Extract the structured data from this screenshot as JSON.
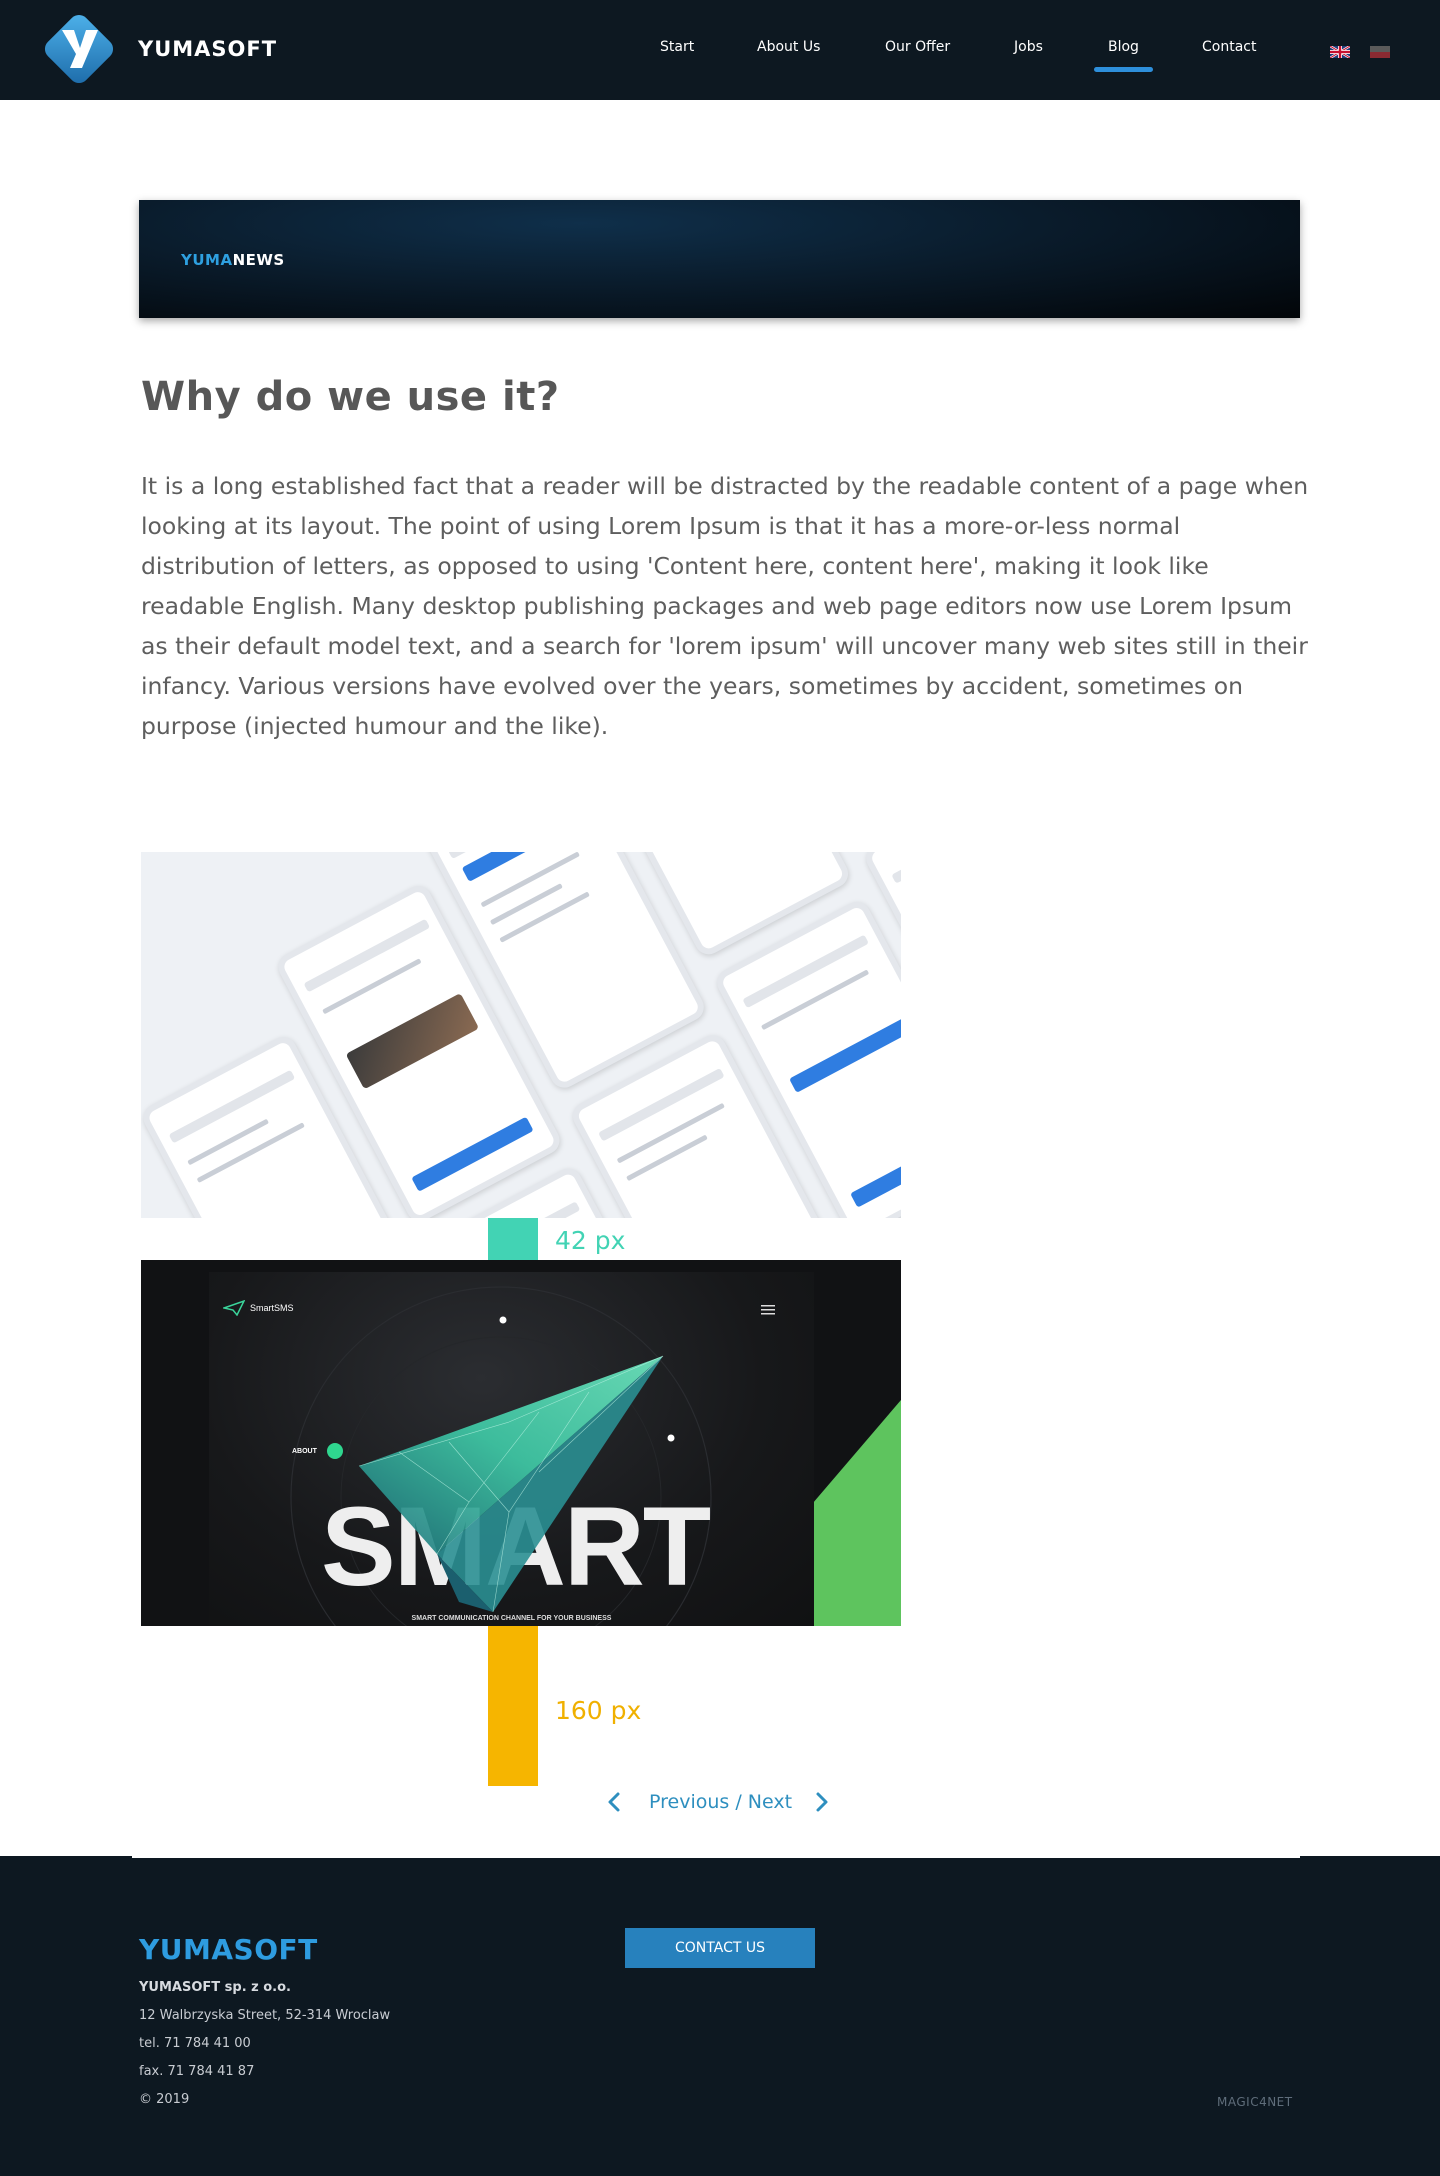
{
  "header": {
    "brand": "YUMASOFT",
    "nav": [
      {
        "label": "Start",
        "active": false
      },
      {
        "label": "About Us",
        "active": false
      },
      {
        "label": "Our Offer",
        "active": false
      },
      {
        "label": "Jobs",
        "active": false
      },
      {
        "label": "Blog",
        "active": true
      },
      {
        "label": "Contact",
        "active": false
      }
    ],
    "languages": [
      "en",
      "pl"
    ],
    "accent_color": "#2e8fdb",
    "background_color": "#0d1821"
  },
  "banner": {
    "tag_prefix": "YUMA",
    "tag_suffix": "NEWS"
  },
  "article": {
    "title": "Why do we use it?",
    "body": "It is a long established fact that a reader will be distracted by the readable content of a page when looking at its layout. The point of using Lorem Ipsum is that it has a more-or-less normal distribution of letters, as opposed to using 'Content here, content here', making it look like readable English. Many desktop publishing packages and web page editors now use Lorem Ipsum as their default model text, and a search for 'lorem ipsum' will uncover many web sites still in their infancy. Various versions have evolved over the years, sometimes by accident, sometimes on purpose (injected humour and the like)."
  },
  "gallery": {
    "spacing_labels": [
      "42 px",
      "160 px"
    ],
    "spacing_colors": [
      "#42d3b4",
      "#f6b500"
    ],
    "smart": {
      "app_name": "SmartSMS",
      "about": "ABOUT",
      "headline": "SMART",
      "tagline": "SMART COMMUNICATION CHANNEL FOR YOUR BUSINESS"
    }
  },
  "pager": {
    "label": "Previous / Next",
    "prev_icon": "chevron-left-icon",
    "next_icon": "chevron-right-icon"
  },
  "footer": {
    "brand": "YUMASOFT",
    "company": "YUMASOFT sp. z o.o.",
    "address": "12 Walbrzyska Street, 52-314 Wroclaw",
    "tel": "tel. 71 784 41 00",
    "fax": "fax. 71 784 41 87",
    "copyright": "© 2019",
    "contact_button": "CONTACT US",
    "credit": "MAGIC4NET"
  }
}
